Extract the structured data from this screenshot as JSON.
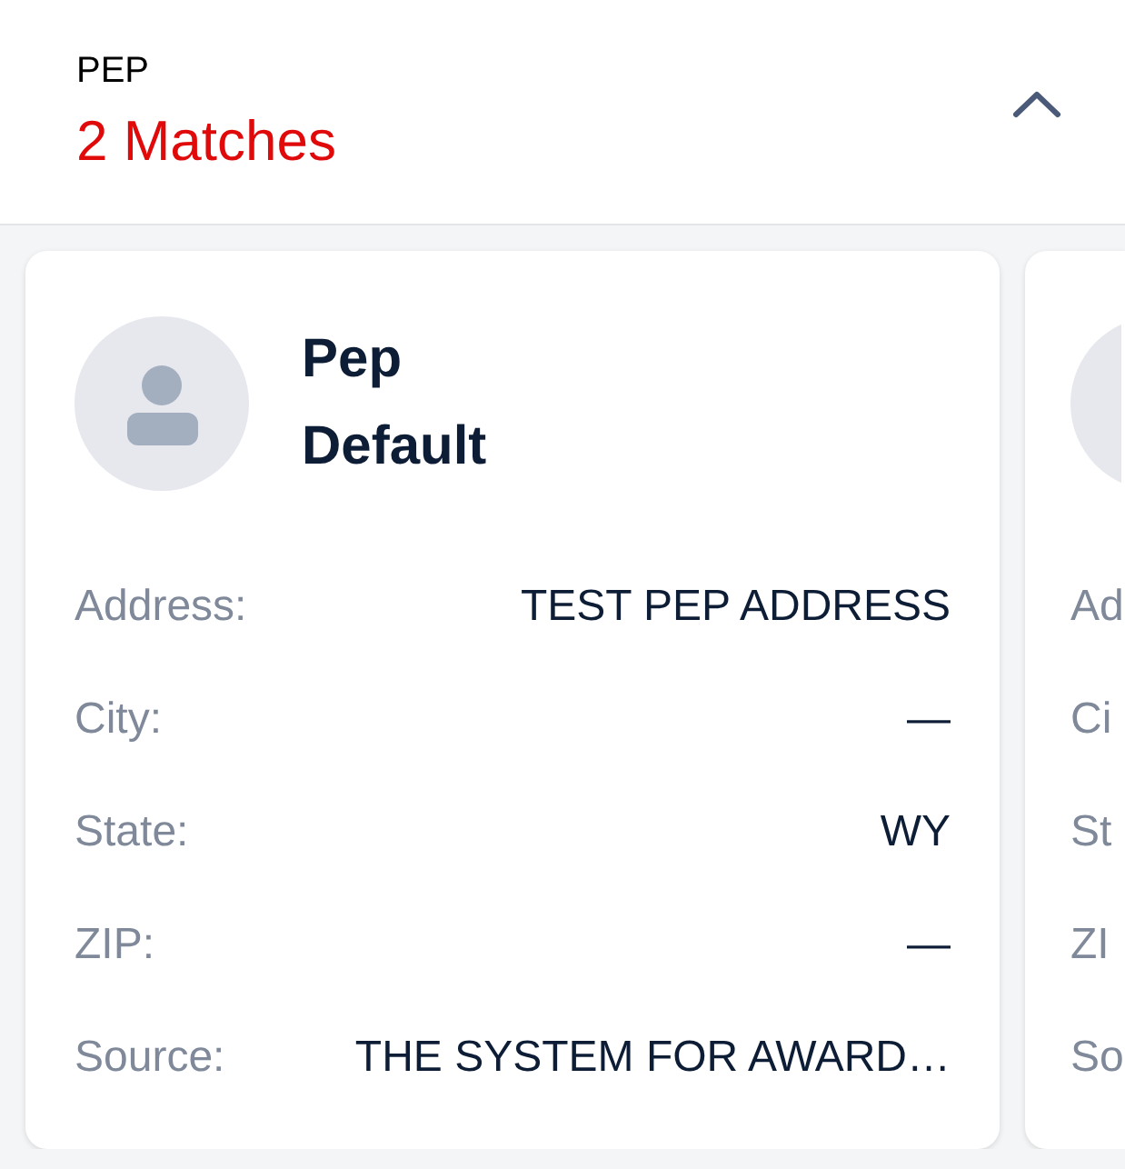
{
  "section": {
    "title": "PEP",
    "match_count": "2 Matches",
    "expanded": true
  },
  "matches": [
    {
      "name": "Pep",
      "subtitle": "Default",
      "fields": [
        {
          "label": "Address:",
          "value": "TEST PEP ADDRESS"
        },
        {
          "label": "City:",
          "value": "—"
        },
        {
          "label": "State:",
          "value": "WY"
        },
        {
          "label": "ZIP:",
          "value": "—"
        },
        {
          "label": "Source:",
          "value": "THE SYSTEM FOR AWARD…"
        }
      ]
    },
    {
      "fields": [
        {
          "label": "Ad"
        },
        {
          "label": "Ci"
        },
        {
          "label": "St"
        },
        {
          "label": "ZI"
        },
        {
          "label": "So"
        }
      ]
    }
  ]
}
